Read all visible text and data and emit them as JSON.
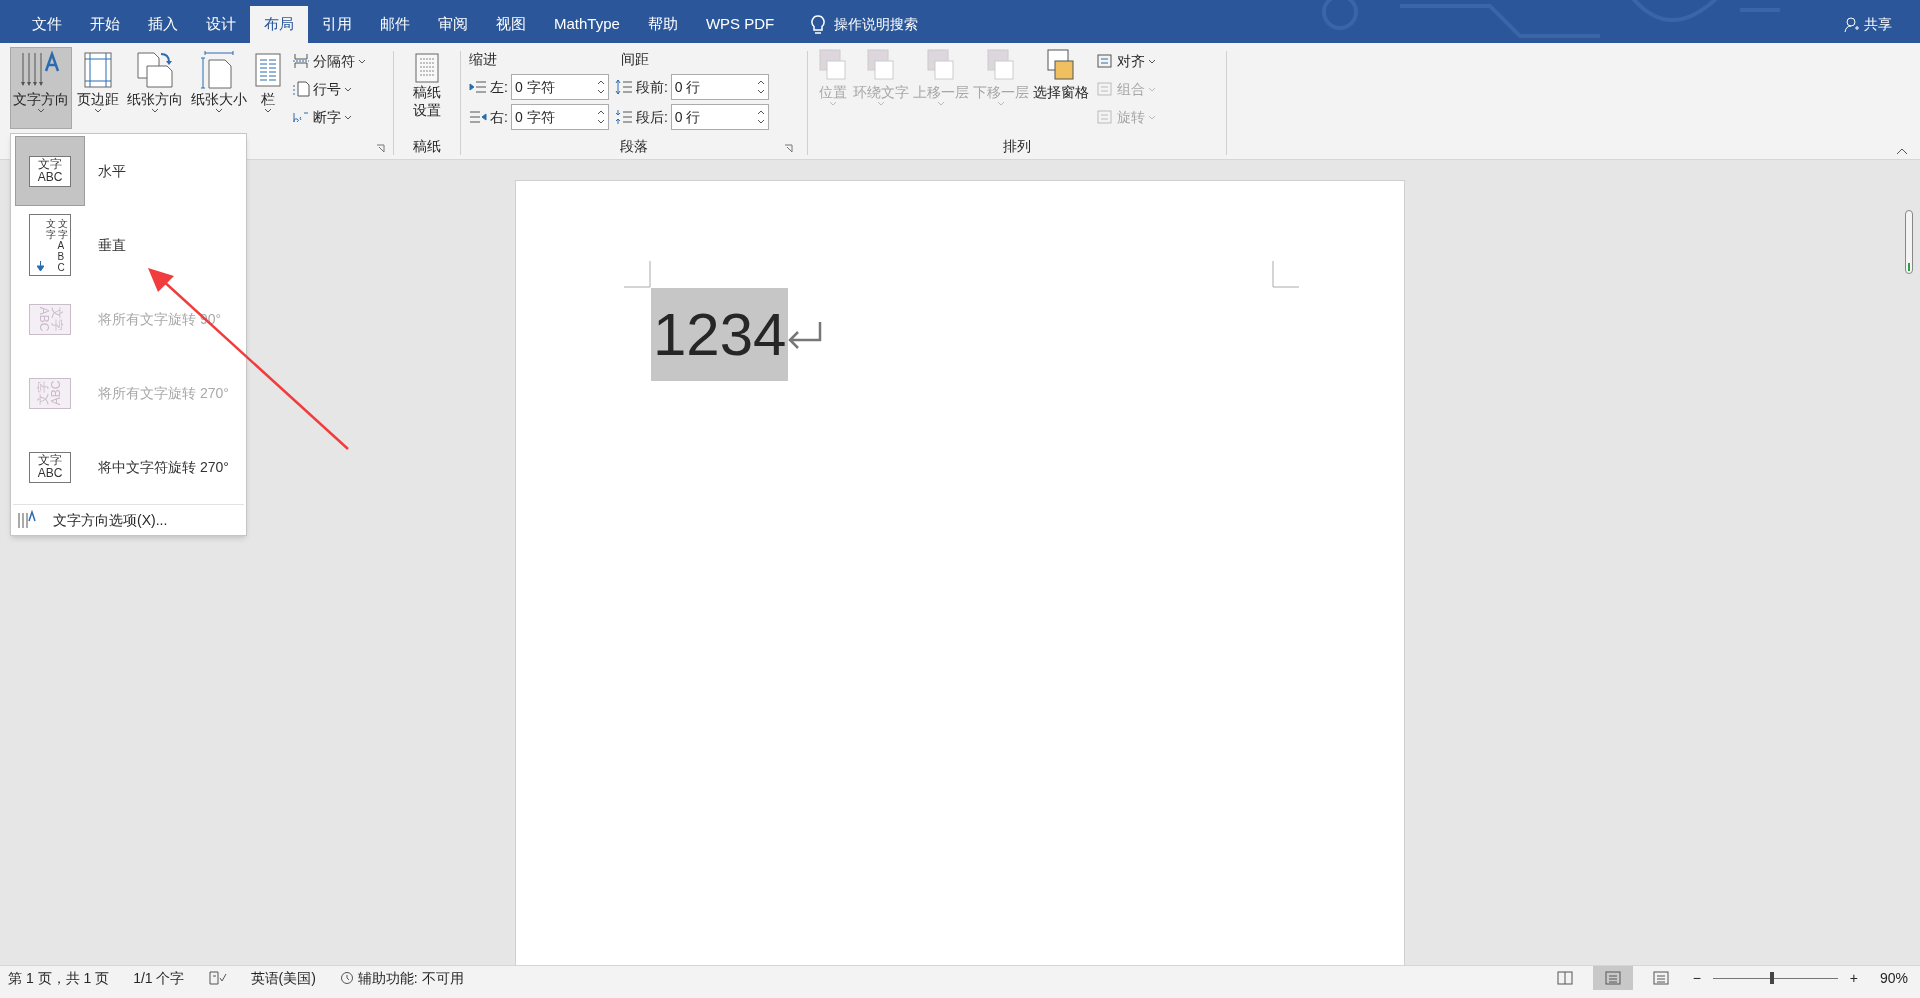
{
  "tabs": [
    {
      "label": "文件",
      "selected": false
    },
    {
      "label": "开始",
      "selected": false
    },
    {
      "label": "插入",
      "selected": false
    },
    {
      "label": "设计",
      "selected": false
    },
    {
      "label": "布局",
      "selected": true
    },
    {
      "label": "引用",
      "selected": false
    },
    {
      "label": "邮件",
      "selected": false
    },
    {
      "label": "审阅",
      "selected": false
    },
    {
      "label": "视图",
      "selected": false
    },
    {
      "label": "MathType",
      "selected": false
    },
    {
      "label": "帮助",
      "selected": false
    },
    {
      "label": "WPS PDF",
      "selected": false
    }
  ],
  "search": {
    "label": "操作说明搜索"
  },
  "share": {
    "label": "共享"
  },
  "page_setup": {
    "buttons": [
      {
        "label": "文字方向",
        "kind": "direction",
        "selected": true
      },
      {
        "label": "页边距",
        "kind": "margins",
        "selected": false
      },
      {
        "label": "纸张方向",
        "kind": "orientation",
        "selected": false
      },
      {
        "label": "纸张大小",
        "kind": "size",
        "selected": false
      },
      {
        "label": "栏",
        "kind": "columns",
        "selected": false
      }
    ],
    "small": [
      {
        "label": "分隔符",
        "kind": "breaks"
      },
      {
        "label": "行号",
        "kind": "lines"
      },
      {
        "label": "断字",
        "kind": "hyphen"
      }
    ]
  },
  "manuscript": {
    "lines": [
      "稿纸",
      "设置"
    ],
    "group_label": "稿纸"
  },
  "paragraph": {
    "indent_label": "缩进",
    "spacing_label": "间距",
    "fields": [
      {
        "label": "左:",
        "value": "0 字符",
        "kind": "indent-left"
      },
      {
        "label": "右:",
        "value": "0 字符",
        "kind": "indent-right"
      },
      {
        "label": "段前:",
        "value": "0 行",
        "kind": "before"
      },
      {
        "label": "段后:",
        "value": "0 行",
        "kind": "after"
      }
    ],
    "group_label": "段落"
  },
  "arrange": {
    "buttons": [
      {
        "label": "位置",
        "disabled": true
      },
      {
        "label": "环绕文字",
        "disabled": true
      },
      {
        "label": "上移一层",
        "disabled": true
      },
      {
        "label": "下移一层",
        "disabled": true
      },
      {
        "label": "选择窗格",
        "disabled": false
      }
    ],
    "small": [
      {
        "label": "对齐",
        "disabled": false
      },
      {
        "label": "组合",
        "disabled": true
      },
      {
        "label": "旋转",
        "disabled": true
      }
    ],
    "group_label": "排列"
  },
  "dropdown": {
    "items": [
      {
        "label": "水平",
        "selected": true,
        "disabled": false,
        "kind": "horizontal",
        "icon_lines": [
          "文字",
          "ABC"
        ]
      },
      {
        "label": "垂直",
        "selected": false,
        "disabled": false,
        "kind": "vertical",
        "icon_lines": [
          "文字",
          "文字ABC"
        ]
      },
      {
        "label": "将所有文字旋转 90°",
        "selected": false,
        "disabled": true,
        "kind": "rot90",
        "icon_lines": [
          "文字",
          "ABC"
        ]
      },
      {
        "label": "将所有文字旋转 270°",
        "selected": false,
        "disabled": true,
        "kind": "rot270",
        "icon_lines": [
          "文字",
          "ABC"
        ]
      },
      {
        "label": "将中文字符旋转 270°",
        "selected": false,
        "disabled": false,
        "kind": "cjk270",
        "icon_lines": [
          "文字",
          "ABC"
        ]
      }
    ],
    "footer": "文字方向选项(X)..."
  },
  "document": {
    "text": "1234",
    "selected": true
  },
  "status_bar": {
    "items": [
      {
        "label": "第 1 页，共 1 页",
        "kind": "text"
      },
      {
        "label": "1/1 个字",
        "kind": "text"
      },
      {
        "kind": "proof"
      },
      {
        "label": "英语(美国)",
        "kind": "text"
      },
      {
        "label": "辅助功能: 不可用",
        "kind": "access"
      }
    ],
    "views": [
      {
        "kind": "read",
        "selected": false
      },
      {
        "kind": "print",
        "selected": true
      },
      {
        "kind": "web",
        "selected": false
      }
    ],
    "zoom": {
      "level": 0.46,
      "label": "90%",
      "zoom_out": "−",
      "zoom_in": "+"
    }
  }
}
